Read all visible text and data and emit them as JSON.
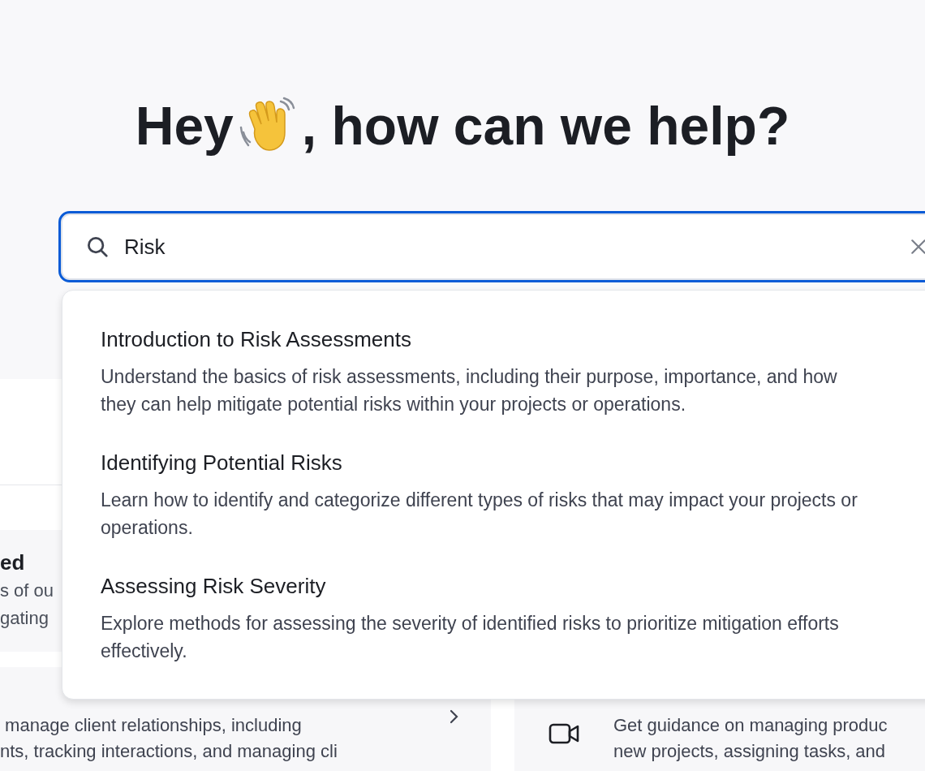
{
  "heading": {
    "before": "Hey",
    "after": ", how can we help?"
  },
  "search": {
    "value": "Risk",
    "focused": true
  },
  "results": [
    {
      "title": "Introduction to Risk Assessments",
      "description": "Understand the basics of risk assessments, including their purpose, importance, and how they can help mitigate potential risks within your projects or operations."
    },
    {
      "title": "Identifying Potential Risks",
      "description": "Learn how to identify and categorize different types of risks that may impact your projects or operations."
    },
    {
      "title": "Assessing Risk Severity",
      "description": "Explore methods for assessing the severity of identified risks to prioritize mitigation efforts effectively."
    }
  ],
  "background_cards": [
    {
      "title": "ed",
      "lines": [
        "s of ou",
        "gating"
      ]
    },
    {
      "lines": [
        " manage client relationships, including",
        "nts, tracking interactions, and managing cli"
      ]
    },
    {
      "lines": [
        "Get guidance on managing produc",
        "new projects, assigning tasks, and"
      ]
    }
  ]
}
